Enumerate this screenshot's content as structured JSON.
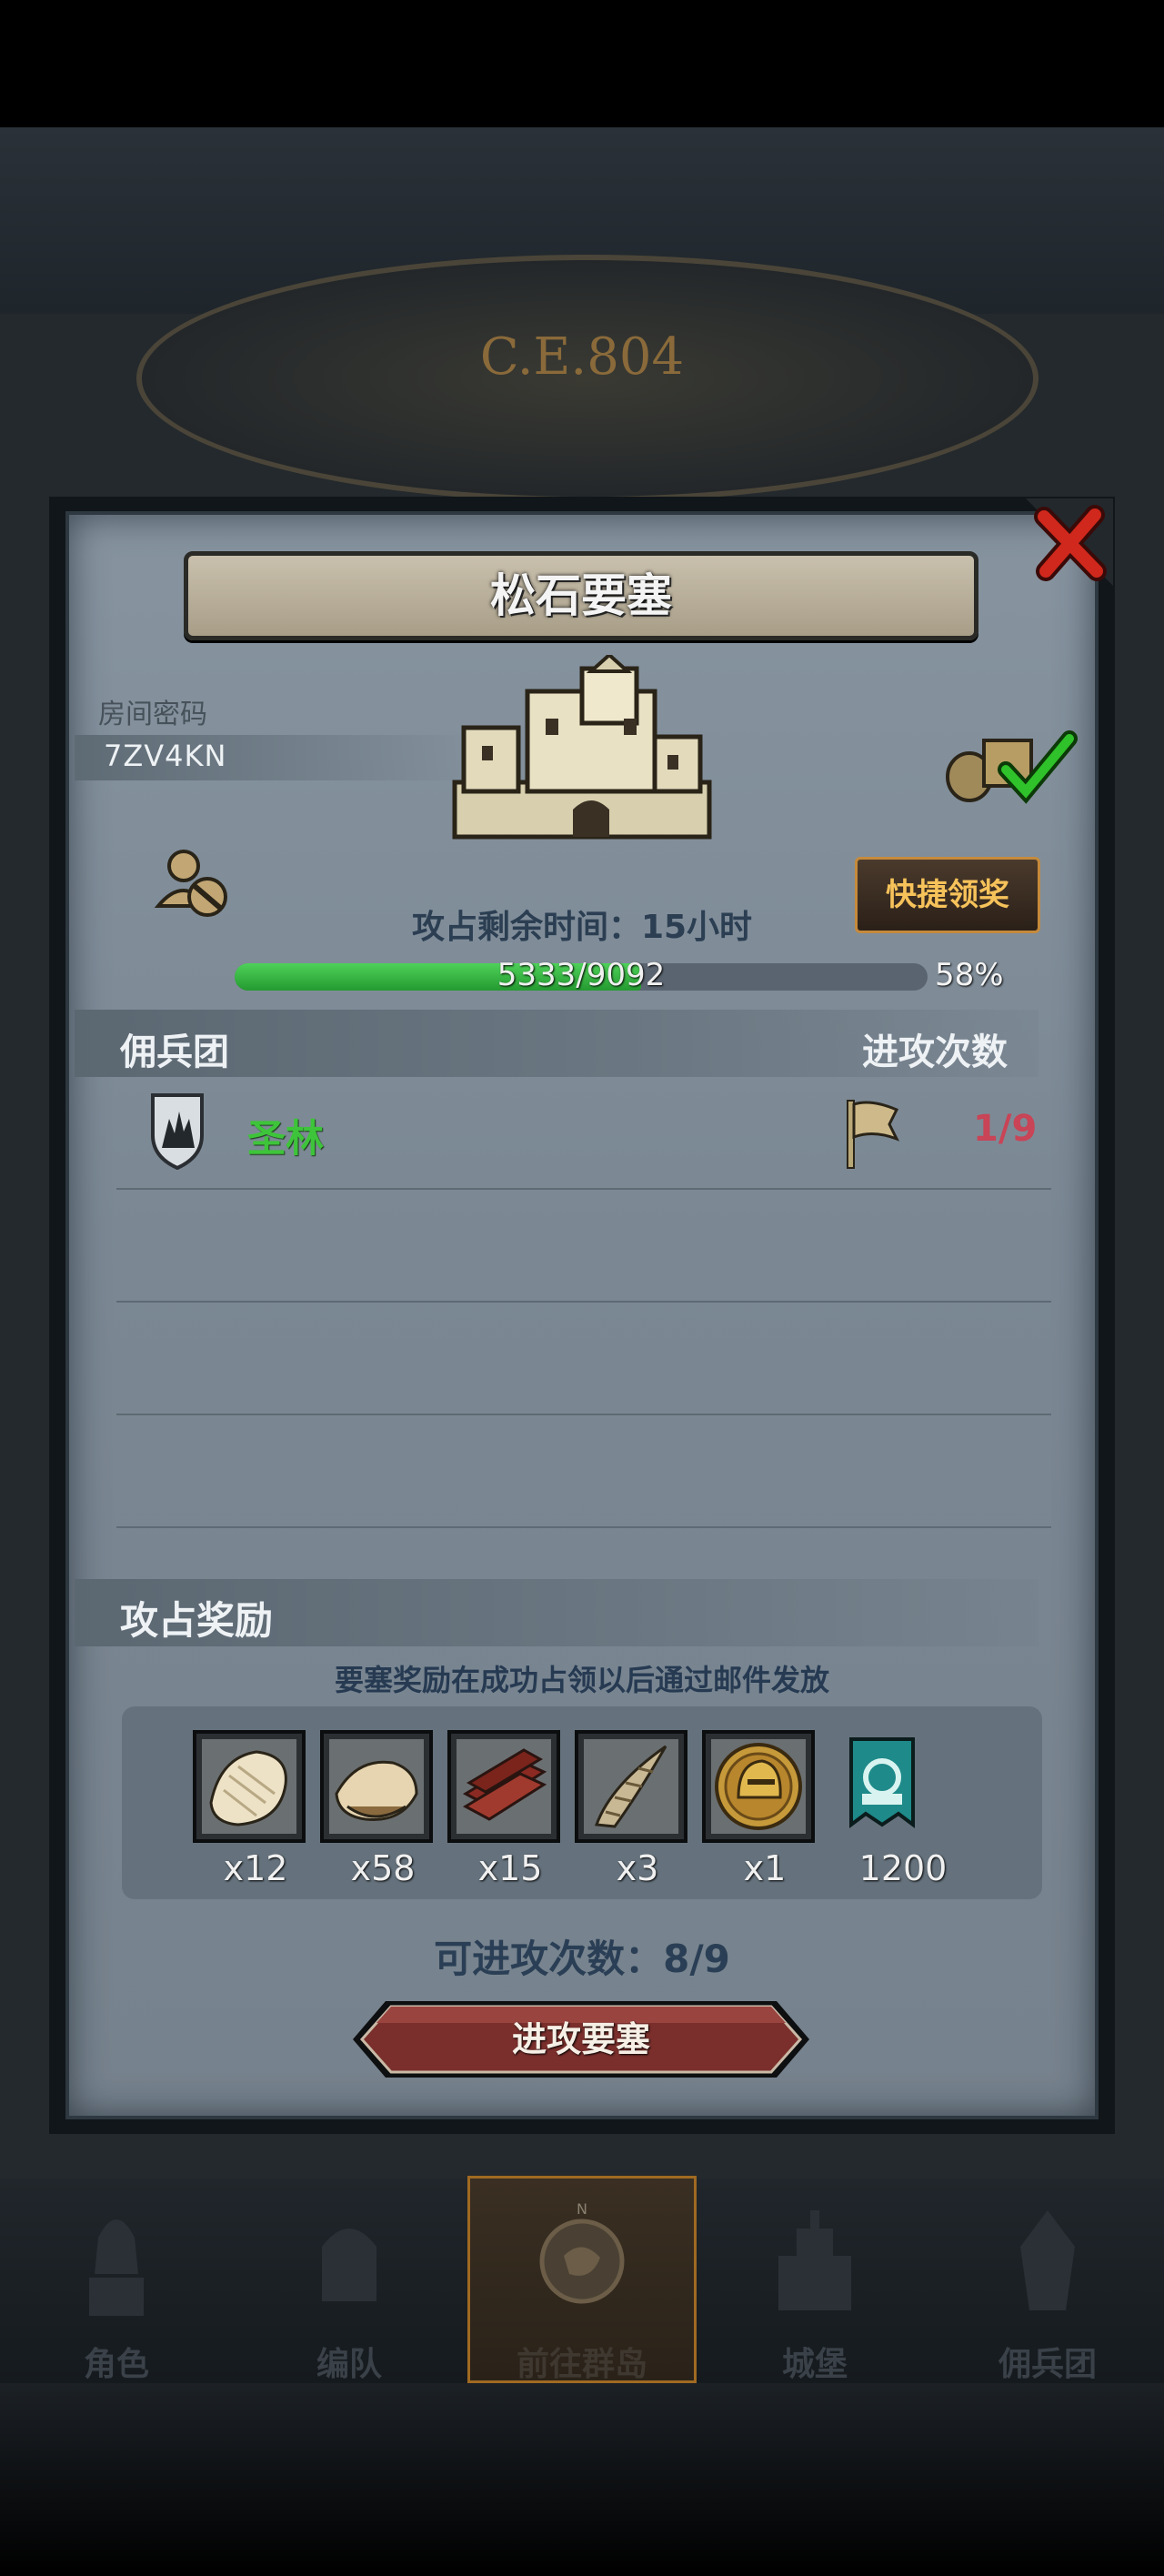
{
  "header": {
    "era": "C.E.804"
  },
  "dialog": {
    "title": "松石要塞",
    "room_label": "房间密码",
    "room_code": "7ZV4KN",
    "quick_claim": "快捷领奖",
    "timer": "攻占剩余时间：15小时",
    "progress": {
      "text": "5333/9092",
      "current": 5333,
      "max": 9092,
      "percent": "58%"
    },
    "mercenary_section": {
      "label": "佣兵团",
      "attack_count_label": "进攻次数",
      "rows": [
        {
          "name": "圣林",
          "count": "1/9"
        }
      ]
    },
    "reward_section": {
      "label": "攻占奖励",
      "note": "要塞奖励在成功占领以后通过邮件发放",
      "items": [
        {
          "icon": "fur-pelt-icon",
          "qty": "x12"
        },
        {
          "icon": "leather-hide-icon",
          "qty": "x58"
        },
        {
          "icon": "wood-planks-icon",
          "qty": "x15"
        },
        {
          "icon": "horn-icon",
          "qty": "x3"
        },
        {
          "icon": "knight-helmet-coin-icon",
          "qty": "x1"
        },
        {
          "icon": "guild-banner-icon",
          "qty": "1200"
        }
      ]
    },
    "available_attacks": "可进攻次数：8/9",
    "attack_button": "进攻要塞"
  },
  "nav": {
    "items": [
      {
        "label": "角色",
        "icon": "knight-icon"
      },
      {
        "label": "编队",
        "icon": "formation-icon"
      },
      {
        "label": "前往群岛",
        "icon": "compass-map-icon",
        "active": true
      },
      {
        "label": "城堡",
        "icon": "castle-icon"
      },
      {
        "label": "佣兵团",
        "icon": "mercenary-icon"
      }
    ]
  },
  "colors": {
    "progress_fill": "#3cb846",
    "merc_name": "#3ec43a",
    "merc_count": "#c84456",
    "quick_claim_text": "#f6c25a",
    "attack_button": "#7a2f2c"
  }
}
